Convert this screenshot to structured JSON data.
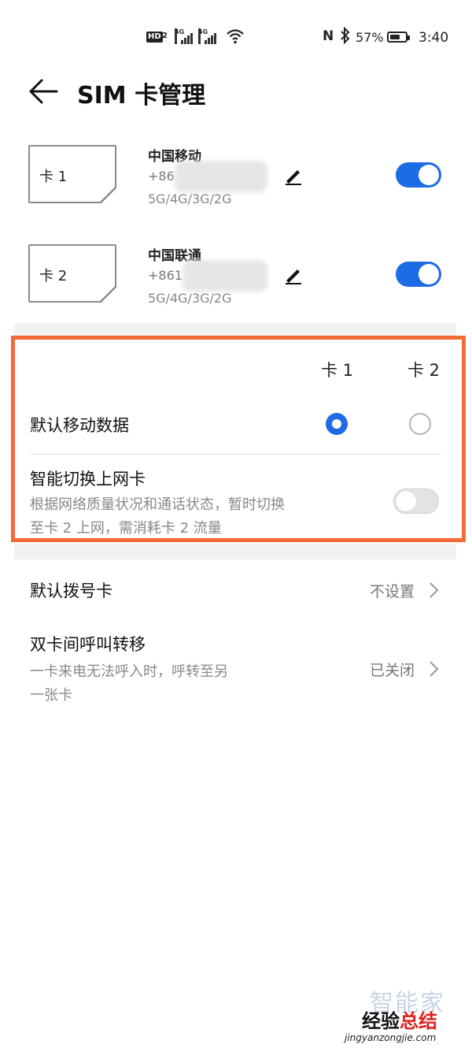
{
  "status_bar": {
    "hd_badge": "HD",
    "hd_sub": "2",
    "signal1_tag": "4G",
    "signal2_tag": "4G",
    "nfc_icon": "N",
    "bluetooth_icon": "bluetooth-icon",
    "battery_percent": "57%",
    "time": "3:40"
  },
  "header": {
    "title": "SIM 卡管理"
  },
  "sims": [
    {
      "card_label": "卡 1",
      "carrier": "中国移动",
      "phone_visible": "+86",
      "networks": "5G/4G/3G/2G",
      "enabled": true
    },
    {
      "card_label": "卡 2",
      "carrier": "中国联通",
      "phone_visible": "+861",
      "networks": "5G/4G/3G/2G",
      "enabled": true
    }
  ],
  "data_section": {
    "col_card1": "卡 1",
    "col_card2": "卡 2",
    "default_data_label": "默认移动数据",
    "default_data_selected": "card1",
    "smart_switch_label": "智能切换上网卡",
    "smart_switch_desc_line1": "根据网络质量状况和通话状态，暂时切换",
    "smart_switch_desc_line2": "至卡 2 上网，需消耗卡 2 流量",
    "smart_switch_enabled": false
  },
  "settings": [
    {
      "label": "默认拨号卡",
      "value": "不设置"
    },
    {
      "label": "双卡间呼叫转移",
      "desc_line1": "一卡来电无法呼入时，呼转至另",
      "desc_line2": "一张卡",
      "value": "已关闭"
    }
  ],
  "watermark": {
    "top": "智能家",
    "main_black": "经验",
    "main_red": "总结",
    "url": "jingyanzongjie.com"
  },
  "colors": {
    "accent": "#1e6be6",
    "highlight_border": "#f36a36"
  }
}
